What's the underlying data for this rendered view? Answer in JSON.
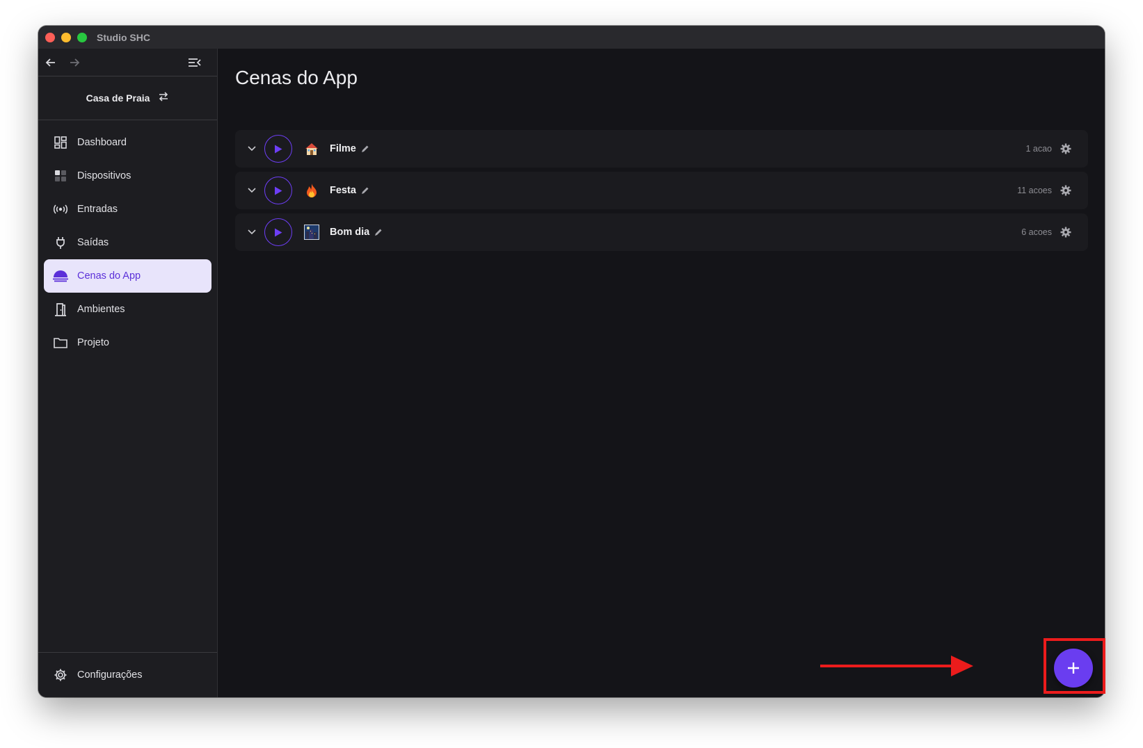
{
  "window": {
    "title": "Studio SHC"
  },
  "sidebar": {
    "site_name": "Casa de Praia",
    "items": [
      {
        "label": "Dashboard",
        "icon": "dashboard-icon"
      },
      {
        "label": "Dispositivos",
        "icon": "devices-icon"
      },
      {
        "label": "Entradas",
        "icon": "radio-signal-icon"
      },
      {
        "label": "Saídas",
        "icon": "plug-icon"
      },
      {
        "label": "Cenas do App",
        "icon": "cloud-icon",
        "active": true
      },
      {
        "label": "Ambientes",
        "icon": "door-icon"
      },
      {
        "label": "Projeto",
        "icon": "folder-icon"
      }
    ],
    "settings_label": "Configurações"
  },
  "main": {
    "title": "Cenas do App",
    "scenes": [
      {
        "name": "Filme",
        "icon": "house-emoji-icon",
        "actions": "1 acao"
      },
      {
        "name": "Festa",
        "icon": "fire-emoji-icon",
        "actions": "11 acoes"
      },
      {
        "name": "Bom dia",
        "icon": "night-city-emoji-icon",
        "actions": "6 acoes"
      }
    ]
  },
  "colors": {
    "accent": "#6a3df0",
    "active_bg": "#e8e4fb",
    "annotation": "#ec1c1c"
  }
}
